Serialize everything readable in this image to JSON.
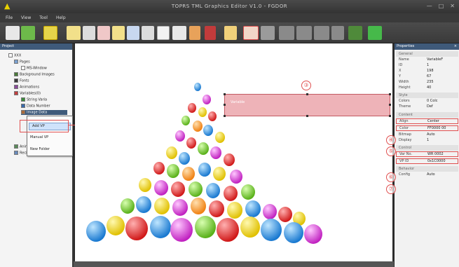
{
  "window": {
    "title": "TOPRS TML Graphics Editor V1.0 - FGDOR"
  },
  "menu": {
    "items": [
      "File",
      "View",
      "Tool",
      "Help"
    ]
  },
  "toolbar_callout": "②",
  "project_panel": {
    "title": "Project",
    "tree": [
      "XXX",
      "Pages",
      "MS-Window",
      "Background Images",
      "Fonts",
      "Animations",
      "Variables(0)",
      "String Varia",
      "Data Number",
      "Image Data",
      "Animation",
      "Recipe/Task"
    ]
  },
  "context_menu": {
    "items": [
      "Add VP",
      "Manual VP",
      "New Folder"
    ],
    "callout": "①"
  },
  "widget": {
    "label": "Variable",
    "callout": "③"
  },
  "properties": {
    "title": "Properties",
    "sections": {
      "general": "General",
      "style": "Style",
      "content": "Content",
      "control": "Control",
      "behavior": "Behavior"
    },
    "rows": [
      {
        "k": "Name",
        "v": "VariableF"
      },
      {
        "k": "ID",
        "v": "1"
      },
      {
        "k": "X",
        "v": "198"
      },
      {
        "k": "Y",
        "v": "67"
      },
      {
        "k": "Width",
        "v": "235"
      },
      {
        "k": "Height",
        "v": "40"
      },
      {
        "k": "Colors",
        "v": "0 Colc"
      },
      {
        "k": "Theme",
        "v": "Def"
      },
      {
        "k": "Align",
        "v": "Center"
      },
      {
        "k": "Color",
        "v": "FF0000 00"
      },
      {
        "k": "Bitmap",
        "v": "Auto"
      },
      {
        "k": "Display",
        "v": "1"
      },
      {
        "k": "Var No.",
        "v": "WR 0002"
      },
      {
        "k": "VP ID",
        "v": "0x1C0000"
      },
      {
        "k": "Config",
        "v": "Auto"
      }
    ],
    "callouts": [
      "④",
      "⑤",
      "⑥",
      "⑦"
    ]
  },
  "colors": {
    "accent_red": "#e05050",
    "header_blue": "#3f5a7a",
    "widget_fill": "#e89aa0"
  }
}
